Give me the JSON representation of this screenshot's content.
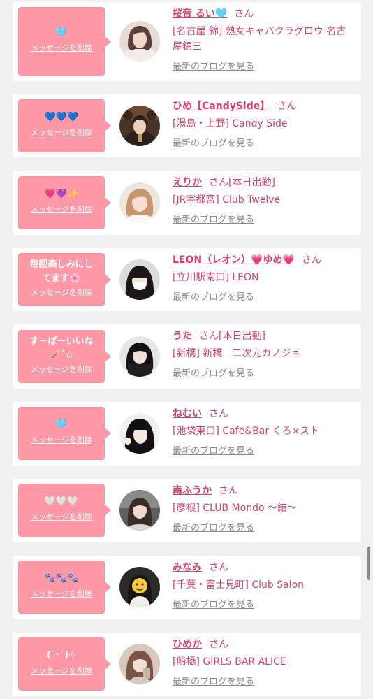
{
  "delete_label": "メッセージを削除",
  "blog_label": "最新のブログを見る",
  "san_label": "さん",
  "colors": {
    "bubble": "#fe98a6",
    "accent": "#d9426b",
    "background": "#f1f1f1"
  },
  "items": [
    {
      "message": "🩵",
      "name": "桜音 るい🩵",
      "status": "",
      "store": "[名古屋 錦] 熟女キャバクラグロウ 名古屋錦三"
    },
    {
      "message": "💙💙💙",
      "name": "ひめ【CandySide】",
      "status": "",
      "store": "[湯島・上野] Candy Side"
    },
    {
      "message": "💗💜✨",
      "name": "えりか",
      "status": "[本日出勤]",
      "store": "[JR宇都宮] Club Twelve"
    },
    {
      "message": "毎回楽しみにしてます🌸",
      "name": "LEON（レオン）💗ゆめ💗",
      "status": "",
      "store": "[立川駅南口] LEON"
    },
    {
      "message": "すーぱーいいね🪄˚✩",
      "name": "うた",
      "status": "[本日出勤]",
      "store": "[新橋] 新橋　二次元カノジョ"
    },
    {
      "message": "🩵",
      "name": "ねむい",
      "status": "",
      "store": "[池袋東口] Cafe&Bar くろ×スト"
    },
    {
      "message": "🤍🤍🤍",
      "name": "南ふうか",
      "status": "",
      "store": "[彦根] CLUB Mondo 〜結〜"
    },
    {
      "message": "🐾🐾🐾",
      "name": "みなみ",
      "status": "",
      "store": "[千葉・富士見町] Club Salon"
    },
    {
      "message": "(˘ᵕ˘)✧",
      "name": "ひめか",
      "status": "",
      "store": "[船橋] GIRLS BAR ALICE"
    }
  ]
}
